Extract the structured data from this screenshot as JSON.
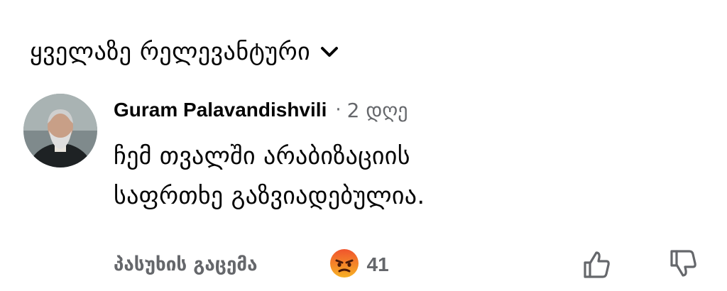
{
  "sort": {
    "label": "ყველაზე რელევანტური",
    "icon": "chevron-down-icon"
  },
  "comment": {
    "author": "Guram Palavandishvili",
    "separator": "·",
    "time": "2 დღე",
    "text_line1": "ჩემ თვალში არაბიზაციის",
    "text_line2": "საფრთხე გაზვიადებულია.",
    "avatar": "avatar-photo"
  },
  "actions": {
    "reply_label": "პასუხის გაცემა",
    "reaction_icon": "angry-emoji-icon",
    "reaction_count": "41",
    "like_icon": "thumbs-up-icon",
    "dislike_icon": "thumbs-down-icon"
  },
  "colors": {
    "text": "#050505",
    "secondary": "#65676b",
    "angry": "#e9710f"
  }
}
